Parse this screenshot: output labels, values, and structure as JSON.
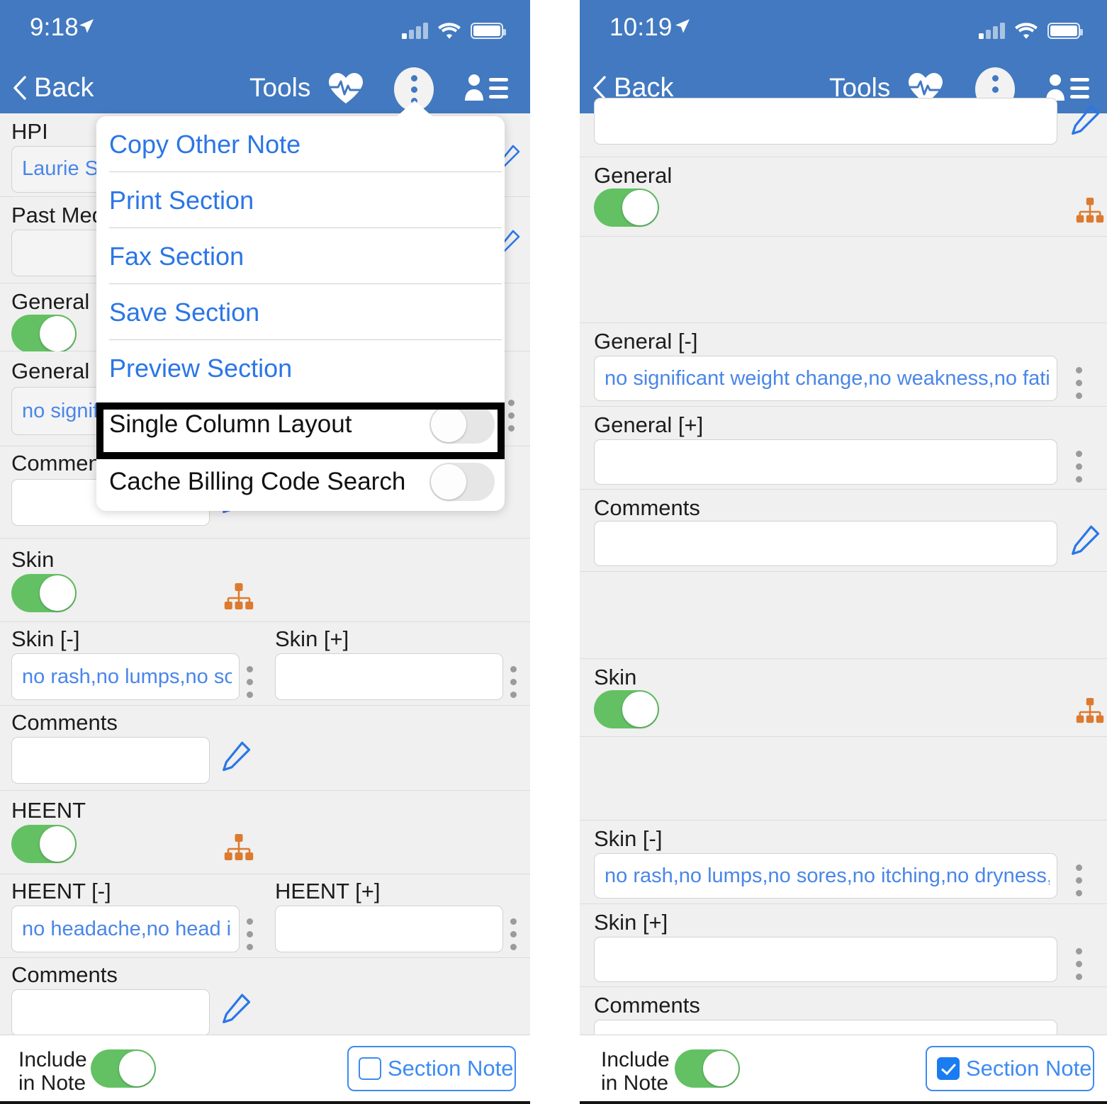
{
  "colors": {
    "header_blue": "#4279c0",
    "link_blue": "#2b76e6",
    "toggle_green": "#63c164",
    "orgchart_orange": "#dd7a2e",
    "value_blue": "#4a86e8"
  },
  "left_phone": {
    "statusbar": {
      "time": "9:18",
      "location_icon": "location-arrow-icon",
      "signal_icon": "cellular-signal-icon",
      "wifi_icon": "wifi-icon",
      "battery_icon": "battery-full-icon"
    },
    "navbar": {
      "back_label": "Back",
      "tools_label": "Tools",
      "vitals_icon": "heart-pulse-icon",
      "more_icon": "three-dots-vertical-icon",
      "patient_icon": "patient-list-icon"
    },
    "popup": {
      "items": [
        {
          "label": "Copy Other Note",
          "type": "link"
        },
        {
          "label": "Print Section",
          "type": "link"
        },
        {
          "label": "Fax Section",
          "type": "link"
        },
        {
          "label": "Save Section",
          "type": "link"
        },
        {
          "label": "Preview Section",
          "type": "link"
        },
        {
          "label": "Single Column Layout",
          "type": "toggle",
          "on": false,
          "highlighted": true
        },
        {
          "label": "Cache Billing Code Search",
          "type": "toggle",
          "on": false,
          "highlighted": false
        }
      ]
    },
    "sections": [
      {
        "label": "HPI",
        "value": "Laurie San\nyears yea"
      },
      {
        "label": "Past Medic",
        "value": ""
      },
      {
        "label": "General",
        "toggle_on": true
      },
      {
        "label": "General [-",
        "value": "no signifi"
      },
      {
        "label": "Comments",
        "value": ""
      },
      {
        "label": "Skin",
        "toggle_on": true,
        "orgchart": "org-chart-icon"
      },
      {
        "label": "Skin [-]",
        "value": "no rash,no lumps,no so..."
      },
      {
        "label": "Skin [+]",
        "value": ""
      },
      {
        "label": "Comments",
        "value": ""
      },
      {
        "label": "HEENT",
        "toggle_on": true,
        "orgchart": "org-chart-icon"
      },
      {
        "label": "HEENT [-]",
        "value": "no headache,no head i..."
      },
      {
        "label": "HEENT [+]",
        "value": ""
      },
      {
        "label": "Comments",
        "value": ""
      }
    ],
    "bottombar": {
      "include_line1": "Include",
      "include_line2": "in Note",
      "include_toggle_on": true,
      "section_note_label": "Section Note",
      "section_note_checked": false
    }
  },
  "right_phone": {
    "statusbar": {
      "time": "10:19",
      "location_icon": "location-arrow-icon",
      "signal_icon": "cellular-signal-icon",
      "wifi_icon": "wifi-icon",
      "battery_icon": "battery-full-icon"
    },
    "navbar": {
      "back_label": "Back",
      "tools_label": "Tools",
      "vitals_icon": "heart-pulse-icon",
      "more_icon": "three-dots-vertical-icon",
      "patient_icon": "patient-list-icon"
    },
    "sections": [
      {
        "label": "",
        "value": ""
      },
      {
        "label": "General",
        "toggle_on": true,
        "orgchart": "org-chart-icon"
      },
      {
        "label": "General [-]",
        "value": "no significant weight change,no weakness,no fatigue,no..."
      },
      {
        "label": "General [+]",
        "value": ""
      },
      {
        "label": "Comments",
        "value": ""
      },
      {
        "label": "Skin",
        "toggle_on": true,
        "orgchart": "org-chart-icon"
      },
      {
        "label": "Skin [-]",
        "value": "no rash,no lumps,no sores,no itching,no dryness,no col..."
      },
      {
        "label": "Skin [+]",
        "value": ""
      },
      {
        "label": "Comments",
        "value": ""
      }
    ],
    "bottombar": {
      "include_line1": "Include",
      "include_line2": "in Note",
      "include_toggle_on": true,
      "section_note_label": "Section Note",
      "section_note_checked": true
    }
  }
}
